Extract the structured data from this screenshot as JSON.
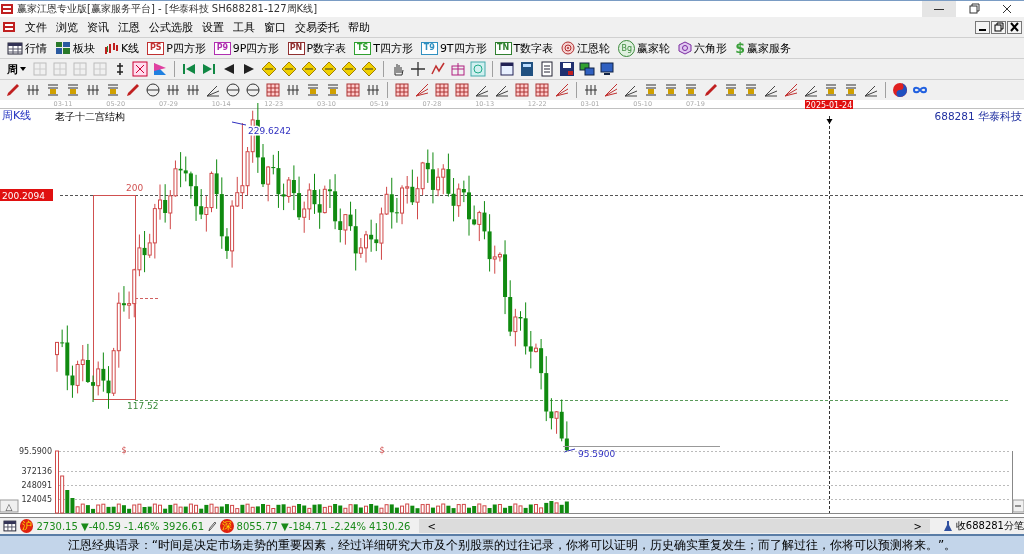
{
  "window": {
    "title": "赢家江恩专业版[赢家服务平台] - [华泰科技  SH688281-127周K线]"
  },
  "menu": {
    "items": [
      "文件",
      "浏览",
      "资讯",
      "江恩",
      "公式选股",
      "设置",
      "工具",
      "窗口",
      "交易委托",
      "帮助"
    ]
  },
  "toolbar": {
    "items": [
      {
        "label": "行情",
        "kind": "table"
      },
      {
        "label": "板块",
        "kind": "blocks"
      },
      {
        "label": "K线",
        "kind": "candles"
      },
      {
        "label": "P四方形",
        "kind": "badge",
        "badge": "PS",
        "color": "#c03030"
      },
      {
        "label": "9P四方形",
        "kind": "badge",
        "badge": "P9",
        "color": "#b030b0"
      },
      {
        "label": "P数字表",
        "kind": "badge",
        "badge": "PN",
        "color": "#903030"
      },
      {
        "label": "T四方形",
        "kind": "badge",
        "badge": "TS",
        "color": "#30a030"
      },
      {
        "label": "9T四方形",
        "kind": "badge",
        "badge": "T9",
        "color": "#3090c0"
      },
      {
        "label": "T数字表",
        "kind": "badge",
        "badge": "TN",
        "color": "#308030"
      },
      {
        "label": "江恩轮",
        "kind": "wheel"
      },
      {
        "label": "赢家轮",
        "kind": "coin",
        "badge": "Bg"
      },
      {
        "label": "六角形",
        "kind": "hexagon"
      },
      {
        "label": "赢家服务",
        "kind": "dollar",
        "badge": "$"
      }
    ]
  },
  "tool_row": {
    "period": "周"
  },
  "chart": {
    "period_label": "周K线",
    "title": "老子十二宫结构",
    "stock": "688281  华泰科技",
    "date_axis": [
      "03-11",
      "05-20",
      "07-29",
      "10-14",
      "12-23",
      "03-10",
      "05-19",
      "07-28",
      "10-13",
      "12-22",
      "03-01",
      "05-10",
      "07-19"
    ],
    "cursor_date": "2025-01-24",
    "price_tag": "200.2094",
    "high_label": "229.6242",
    "box_top_label": "200",
    "box_bottom_label": "117.52",
    "low_label": "95.5900",
    "volume_axis": [
      "95.5900",
      "372136",
      "248091",
      "124045"
    ],
    "markers": [
      "$",
      "$"
    ],
    "toggle": "△"
  },
  "index_bar": {
    "indices": [
      {
        "icon": "沪",
        "text": "2730.15 ▼-40.59 -1.46% 3926.61"
      },
      {
        "icon": "深",
        "text": "8055.77 ▼-184.71 -2.24% 4130.26"
      }
    ],
    "scroll_left": "<",
    "scroll_right": ">",
    "status": "收688281分笔"
  },
  "quote": "江恩经典语录：“时间是决定市场走势的重要因素，经过详细研究大市及个别股票的过往记录，你将可以证明，历史确实重复发生；而了解过往，你将可以预测将来。”。"
}
